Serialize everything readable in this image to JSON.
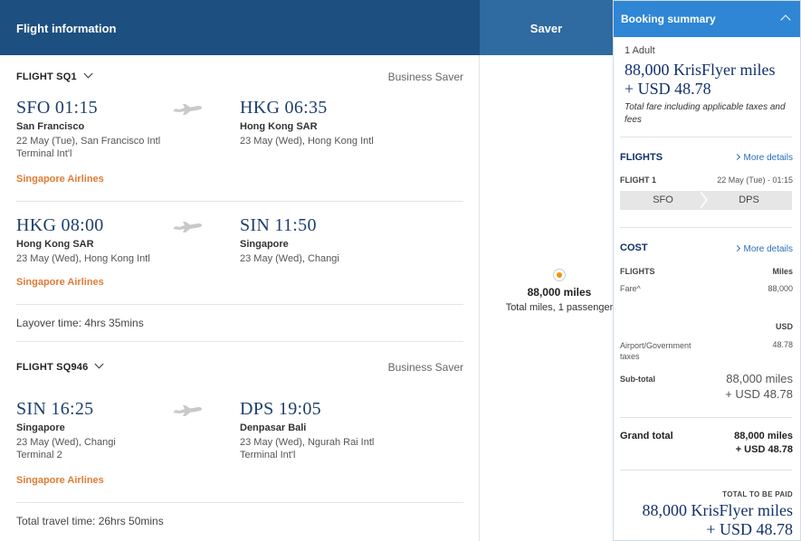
{
  "header": {
    "flight_information": "Flight information",
    "saver": "Saver"
  },
  "flights": [
    {
      "label": "FLIGHT SQ1",
      "fare_class": "Business Saver",
      "segments": [
        {
          "dep_time": "SFO 01:15",
          "dep_city": "San Francisco",
          "dep_detail1": "22 May (Tue), San Francisco Intl",
          "dep_detail2": "Terminal Int'l",
          "arr_time": "HKG 06:35",
          "arr_city": "Hong Kong SAR",
          "arr_detail1": "23 May (Wed), Hong Kong Intl",
          "arr_detail2": "",
          "airline": "Singapore Airlines"
        },
        {
          "dep_time": "HKG 08:00",
          "dep_city": "Hong Kong SAR",
          "dep_detail1": "23 May (Wed), Hong Kong Intl",
          "dep_detail2": "",
          "arr_time": "SIN 11:50",
          "arr_city": "Singapore",
          "arr_detail1": "23 May (Wed), Changi",
          "arr_detail2": "",
          "airline": "Singapore Airlines"
        }
      ],
      "layover": "Layover time: 4hrs 35mins"
    },
    {
      "label": "FLIGHT SQ946",
      "fare_class": "Business Saver",
      "segments": [
        {
          "dep_time": "SIN 16:25",
          "dep_city": "Singapore",
          "dep_detail1": "23 May (Wed), Changi",
          "dep_detail2": "Terminal 2",
          "arr_time": "DPS 19:05",
          "arr_city": "Denpasar Bali",
          "arr_detail1": "23 May (Wed), Ngurah Rai Intl",
          "arr_detail2": "Terminal Int'l",
          "airline": "Singapore Airlines"
        }
      ],
      "total_travel": "Total travel time: 26hrs 50mins"
    }
  ],
  "saver_option": {
    "miles": "88,000 miles",
    "sub": "Total miles, 1 passenger"
  },
  "summary": {
    "title": "Booking summary",
    "passengers": "1 Adult",
    "total_miles": "88,000 KrisFlyer miles",
    "total_usd": "+ USD 48.78",
    "fare_note": "Total fare including applicable taxes and fees",
    "flights_heading": "FLIGHTS",
    "more_details": "More details",
    "flight1_label": "FLIGHT 1",
    "flight1_date": "22 May (Tue) - 01:15",
    "route_from": "SFO",
    "route_to": "DPS",
    "cost_heading": "COST",
    "cost_flights": "FLIGHTS",
    "cost_miles_col": "Miles",
    "fare_label": "Fare^",
    "fare_value": "88,000",
    "usd_col": "USD",
    "taxes_label": "Airport/Government taxes",
    "taxes_value": "48.78",
    "subtotal_label": "Sub-total",
    "subtotal_miles": "88,000 miles",
    "subtotal_usd": "+ USD 48.78",
    "grand_label": "Grand total",
    "grand_miles": "88,000 miles",
    "grand_usd": "+ USD 48.78",
    "to_pay_label": "TOTAL TO BE PAID",
    "to_pay_miles": "88,000 KrisFlyer miles",
    "to_pay_usd": "+ USD 48.78"
  },
  "colors": {
    "header_dark": "#1d4f80",
    "header_saver": "#2f6aa0",
    "summary_header": "#2f86d4",
    "airline_orange": "#e07b35",
    "radio_selected": "#f29100"
  }
}
